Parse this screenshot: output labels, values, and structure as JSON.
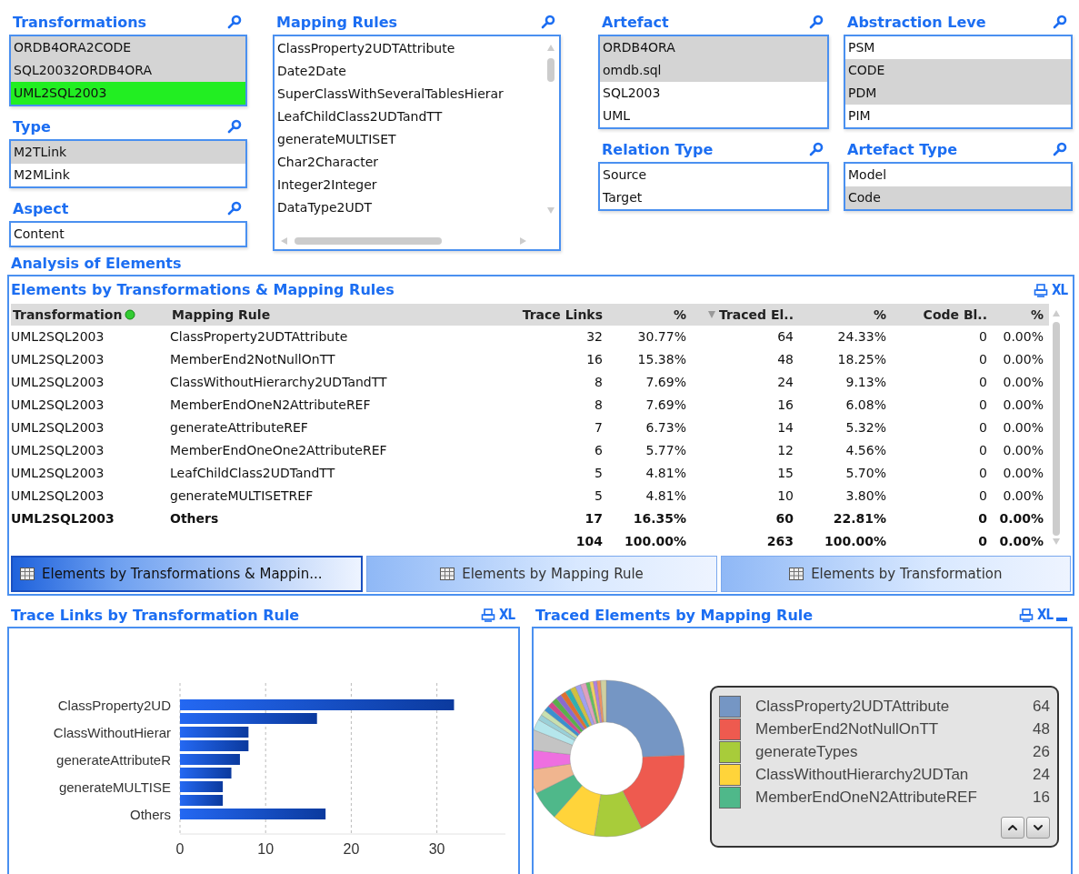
{
  "filter_columns": [
    [
      {
        "title": "Transformations",
        "items": [
          {
            "label": "ORDB4ORA2CODE",
            "selected": false,
            "excluded": true
          },
          {
            "label": "SQL20032ORDB4ORA",
            "selected": false,
            "excluded": true
          },
          {
            "label": "UML2SQL2003",
            "selected": true,
            "excluded": false
          }
        ]
      },
      {
        "title": "Type",
        "items": [
          {
            "label": "M2TLink",
            "selected": false,
            "excluded": true
          },
          {
            "label": "M2MLink",
            "selected": false,
            "excluded": false
          }
        ]
      },
      {
        "title": "Aspect",
        "items": [
          {
            "label": "Content",
            "selected": false,
            "excluded": false
          }
        ]
      }
    ],
    [
      {
        "title": "Mapping Rules",
        "scrollable": true,
        "items": [
          {
            "label": "ClassProperty2UDTAttribute",
            "selected": false,
            "excluded": false
          },
          {
            "label": "Date2Date",
            "selected": false,
            "excluded": false
          },
          {
            "label": "SuperClassWithSeveralTablesHierar",
            "selected": false,
            "excluded": false
          },
          {
            "label": "LeafChildClass2UDTandTT",
            "selected": false,
            "excluded": false
          },
          {
            "label": "generateMULTISET",
            "selected": false,
            "excluded": false
          },
          {
            "label": "Char2Character",
            "selected": false,
            "excluded": false
          },
          {
            "label": "Integer2Integer",
            "selected": false,
            "excluded": false
          },
          {
            "label": "DataType2UDT",
            "selected": false,
            "excluded": false
          }
        ]
      }
    ],
    [
      {
        "title": "Artefact",
        "items": [
          {
            "label": "ORDB4ORA",
            "selected": false,
            "excluded": true
          },
          {
            "label": "omdb.sql",
            "selected": false,
            "excluded": true
          },
          {
            "label": "SQL2003",
            "selected": false,
            "excluded": false
          },
          {
            "label": "UML",
            "selected": false,
            "excluded": false
          }
        ]
      },
      {
        "title": "Relation Type",
        "items": [
          {
            "label": "Source",
            "selected": false,
            "excluded": false
          },
          {
            "label": "Target",
            "selected": false,
            "excluded": false
          }
        ]
      }
    ],
    [
      {
        "title": "Abstraction Leve",
        "items": [
          {
            "label": "PSM",
            "selected": false,
            "excluded": false
          },
          {
            "label": "CODE",
            "selected": false,
            "excluded": true
          },
          {
            "label": "PDM",
            "selected": false,
            "excluded": true
          },
          {
            "label": "PIM",
            "selected": false,
            "excluded": false
          }
        ]
      },
      {
        "title": "Artefact Type",
        "items": [
          {
            "label": "Model",
            "selected": false,
            "excluded": false
          },
          {
            "label": "Code",
            "selected": false,
            "excluded": true
          }
        ]
      }
    ]
  ],
  "section_title": "Analysis of Elements",
  "table_panel": {
    "title": "Elements by Transformations & Mapping Rules",
    "xl": "XL",
    "columns": [
      "Transformation",
      "Mapping Rule",
      "Trace Links",
      "%",
      "Traced El..",
      "%",
      "Code Bl..",
      "%"
    ],
    "rows": [
      {
        "kind": "detail",
        "cells": [
          "UML2SQL2003",
          "ClassProperty2UDTAttribute",
          "32",
          "30.77%",
          "64",
          "24.33%",
          "0",
          "0.00%"
        ]
      },
      {
        "kind": "detail",
        "cells": [
          "UML2SQL2003",
          "MemberEnd2NotNullOnTT",
          "16",
          "15.38%",
          "48",
          "18.25%",
          "0",
          "0.00%"
        ]
      },
      {
        "kind": "detail",
        "cells": [
          "UML2SQL2003",
          "ClassWithoutHierarchy2UDTandTT",
          "8",
          "7.69%",
          "24",
          "9.13%",
          "0",
          "0.00%"
        ]
      },
      {
        "kind": "detail",
        "cells": [
          "UML2SQL2003",
          "MemberEndOneN2AttributeREF",
          "8",
          "7.69%",
          "16",
          "6.08%",
          "0",
          "0.00%"
        ]
      },
      {
        "kind": "detail",
        "cells": [
          "UML2SQL2003",
          "generateAttributeREF",
          "7",
          "6.73%",
          "14",
          "5.32%",
          "0",
          "0.00%"
        ]
      },
      {
        "kind": "detail",
        "cells": [
          "UML2SQL2003",
          "MemberEndOneOne2AttributeREF",
          "6",
          "5.77%",
          "12",
          "4.56%",
          "0",
          "0.00%"
        ]
      },
      {
        "kind": "detail",
        "cells": [
          "UML2SQL2003",
          "LeafChildClass2UDTandTT",
          "5",
          "4.81%",
          "15",
          "5.70%",
          "0",
          "0.00%"
        ]
      },
      {
        "kind": "detail",
        "cells": [
          "UML2SQL2003",
          "generateMULTISETREF",
          "5",
          "4.81%",
          "10",
          "3.80%",
          "0",
          "0.00%"
        ]
      },
      {
        "kind": "others",
        "cells": [
          "UML2SQL2003",
          "Others",
          "17",
          "16.35%",
          "60",
          "22.81%",
          "0",
          "0.00%"
        ]
      },
      {
        "kind": "total",
        "cells": [
          null,
          null,
          "104",
          "100.00%",
          "263",
          "100.00%",
          "0",
          "0.00%"
        ]
      }
    ],
    "tabs": [
      {
        "label": "Elements by Transformations & Mappin...",
        "selected": true
      },
      {
        "label": "Elements by Mapping Rule",
        "selected": false
      },
      {
        "label": "Elements by Transformation",
        "selected": false
      }
    ]
  },
  "trace_links_panel": {
    "title": "Trace Links by Transformation Rule",
    "xl": "XL",
    "chart_data": {
      "type": "bar",
      "orientation": "horizontal",
      "grid": true,
      "xlim": [
        0,
        38
      ],
      "categories": [
        "ClassProperty2UD",
        null,
        "ClassWithoutHierar",
        null,
        "generateAttributeR",
        null,
        "generateMULTISE",
        null,
        "Others"
      ],
      "values": [
        32,
        16,
        8,
        8,
        7,
        6,
        5,
        5,
        17
      ],
      "xticks": [
        0,
        10,
        20,
        30
      ]
    }
  },
  "traced_elements_panel": {
    "title": "Traced Elements by Mapping Rule",
    "xl": "XL",
    "chart_data": {
      "type": "donut",
      "categories": [
        "ClassProperty2UDTAttribute",
        "MemberEnd2NotNullOnTT",
        "generateTypes",
        "ClassWithoutHierarchy2UDTan",
        "MemberEndOneN2AttributeREF",
        null,
        null,
        null,
        null,
        null,
        null,
        null,
        null,
        null,
        null,
        null,
        null,
        null,
        null,
        null,
        null,
        null,
        null,
        null,
        null
      ],
      "values": [
        24.33,
        18.25,
        9.89,
        9.13,
        6.08,
        4.94,
        4.18,
        4.18,
        2.28,
        1.14,
        1.14,
        1.14,
        1.14,
        1.14,
        1.14,
        1.14,
        1.14,
        1.14,
        1.14,
        1.14,
        0.76,
        0.76,
        0.76,
        0.76,
        1.16
      ]
    },
    "legend": [
      {
        "value": "64",
        "color": "#7596c4"
      },
      {
        "value": "48",
        "color": "#ee5a4f"
      },
      {
        "value": "26",
        "color": "#a8cc3a"
      },
      {
        "value": "24",
        "color": "#ffd43a"
      },
      {
        "value": "16",
        "color": "#4fb88a"
      }
    ]
  }
}
